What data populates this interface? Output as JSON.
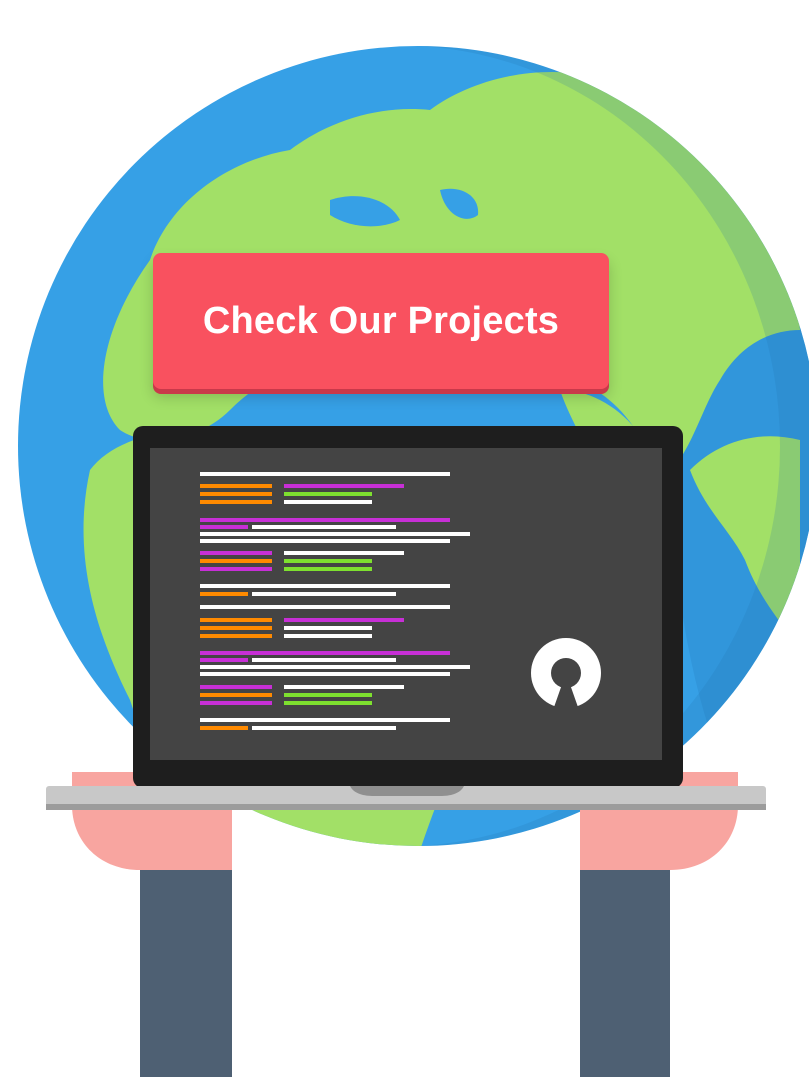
{
  "cta": {
    "label": "Check Our Projects"
  },
  "colors": {
    "cta_background": "#f9515f",
    "ocean": "#36a0e6",
    "land": "#a2e067",
    "screen": "#444444",
    "bezel": "#1e1e1e",
    "hands": "#f8a5a0",
    "arms": "#4e6073",
    "laptop_base": "#c8c8c8"
  },
  "icons": {
    "screen_logo": "open-source-initiative-icon",
    "globe": "world-globe-icon"
  }
}
